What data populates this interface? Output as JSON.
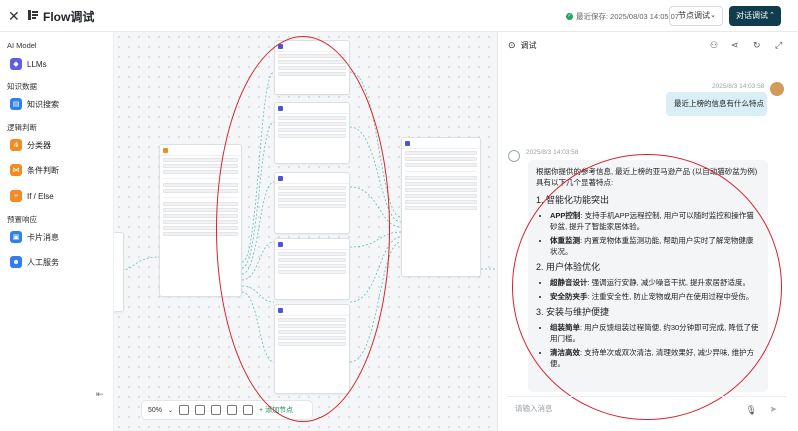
{
  "header": {
    "title": "Flow调试",
    "saved_text": "最近保存: 2025/08/03 14:05:07",
    "debug_button": "节点调试",
    "chat_button": "对话调试"
  },
  "sidebar": {
    "sections": [
      {
        "title": "AI Model",
        "items": [
          {
            "label": "LLMs",
            "icon": "llm-icon",
            "color": "#5b5fe0"
          }
        ]
      },
      {
        "title": "知识数据",
        "items": [
          {
            "label": "知识搜索",
            "icon": "knowledge-icon",
            "color": "#2f80ed"
          }
        ]
      },
      {
        "title": "逻辑判断",
        "items": [
          {
            "label": "分类器",
            "icon": "classifier-icon",
            "color": "#f08c24"
          },
          {
            "label": "条件判断",
            "icon": "condition-icon",
            "color": "#f08c24"
          },
          {
            "label": "If / Else",
            "icon": "ifelse-icon",
            "color": "#f08c24"
          }
        ]
      },
      {
        "title": "预置响应",
        "items": [
          {
            "label": "卡片消息",
            "icon": "card-icon",
            "color": "#2f80ed"
          },
          {
            "label": "人工服务",
            "icon": "human-service-icon",
            "color": "#2f80ed"
          }
        ]
      }
    ]
  },
  "canvas_toolbar": {
    "zoom": "50%",
    "add_node": "添加节点"
  },
  "chat": {
    "title": "调试",
    "user_time": "2025/8/3 14:03:58",
    "user_message": "最近上榜的信息有什么特点",
    "bot_time": "2025/8/3 14:03:58",
    "input_placeholder": "请输入消息",
    "bot_intro": "根据你提供的参考信息, 最近上榜的亚马逊产品 (以自动猫砂盆为例) 具有以下几个显著特点:",
    "sections": [
      {
        "heading": "1. 智能化功能突出",
        "bullets": [
          {
            "bold": "APP控制",
            "text": ": 支持手机APP远程控制, 用户可以随时监控和操作猫砂盆, 提升了智能家居体验。"
          },
          {
            "bold": "体重监测",
            "text": ": 内置宠物体重监测功能, 帮助用户实时了解宠物健康状况。"
          }
        ]
      },
      {
        "heading": "2. 用户体验优化",
        "bullets": [
          {
            "bold": "超静音设计",
            "text": ": 强调运行安静, 减少噪音干扰, 提升家居舒适度。"
          },
          {
            "bold": "安全防夹手",
            "text": ": 注重安全性, 防止宠物或用户在使用过程中受伤。"
          }
        ]
      },
      {
        "heading": "3. 安装与维护便捷",
        "bullets": [
          {
            "bold": "组装简单",
            "text": ": 用户反馈组装过程简便, 约30分钟即可完成, 降低了使用门槛。"
          },
          {
            "bold": "清洁高效",
            "text": ": 支持单次或双次清洁, 清理效果好, 减少异味, 维护方便。"
          }
        ]
      }
    ]
  }
}
